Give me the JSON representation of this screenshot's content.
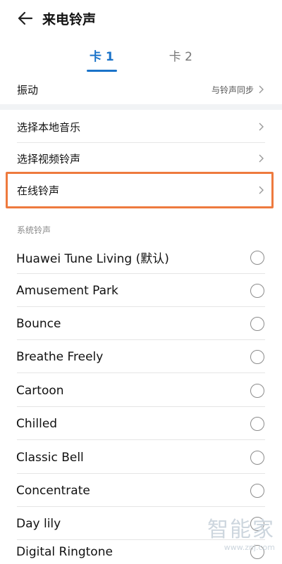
{
  "header": {
    "title": "来电铃声"
  },
  "tabs": [
    {
      "label": "卡 1",
      "active": true
    },
    {
      "label": "卡 2",
      "active": false
    }
  ],
  "vibration": {
    "label": "振动",
    "value": "与铃声同步"
  },
  "options": [
    {
      "label": "选择本地音乐"
    },
    {
      "label": "选择视频铃声"
    },
    {
      "label": "在线铃声"
    }
  ],
  "section_header": "系统铃声",
  "ringtones": [
    {
      "name": "Huawei Tune Living (默认)"
    },
    {
      "name": "Amusement Park"
    },
    {
      "name": "Bounce"
    },
    {
      "name": "Breathe Freely"
    },
    {
      "name": "Cartoon"
    },
    {
      "name": "Chilled"
    },
    {
      "name": "Classic Bell"
    },
    {
      "name": "Concentrate"
    },
    {
      "name": "Day lily"
    },
    {
      "name": "Digital Ringtone"
    }
  ],
  "watermark": {
    "text": "智能家",
    "url": "www.znj.com"
  },
  "colors": {
    "accent": "#1a73c9",
    "highlight": "#ee7a3e"
  }
}
